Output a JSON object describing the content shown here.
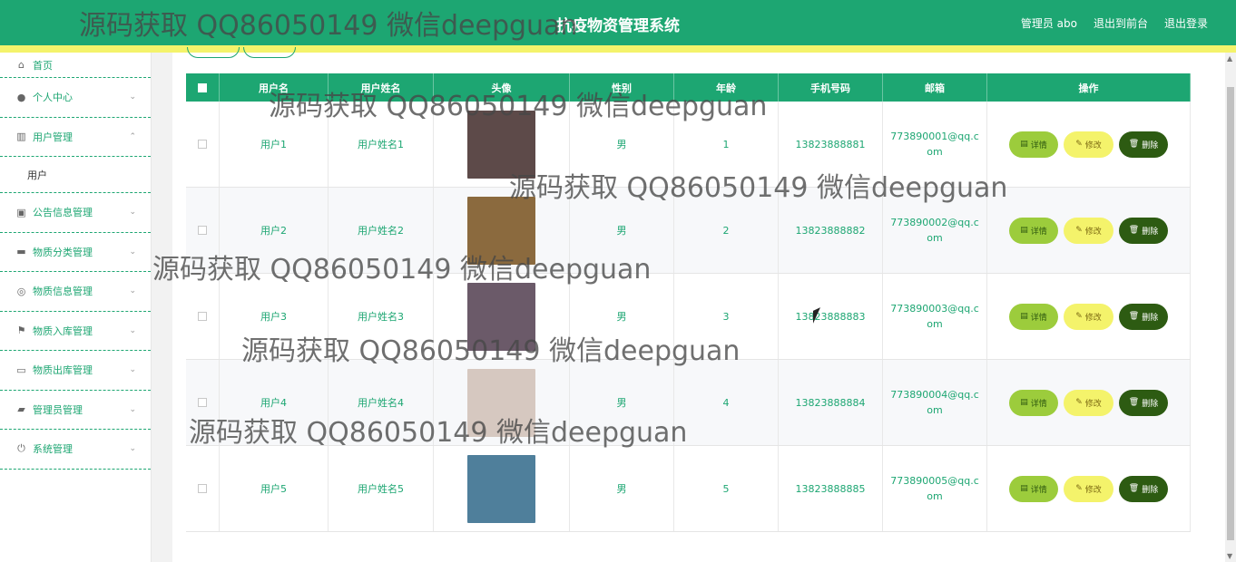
{
  "header": {
    "title": "抗疫物资管理系统",
    "links": [
      "管理员 abo",
      "退出到前台",
      "退出登录"
    ]
  },
  "sidebar": {
    "items": [
      {
        "label": "首页",
        "icon": "home-icon"
      },
      {
        "label": "个人中心",
        "icon": "user-icon"
      },
      {
        "label": "用户管理",
        "icon": "chart-icon"
      },
      {
        "label": "用户",
        "icon": ""
      },
      {
        "label": "公告信息管理",
        "icon": "clipboard-icon"
      },
      {
        "label": "物质分类管理",
        "icon": "briefcase-icon"
      },
      {
        "label": "物质信息管理",
        "icon": "target-icon"
      },
      {
        "label": "物质入库管理",
        "icon": "flag-icon"
      },
      {
        "label": "物质出库管理",
        "icon": "message-icon"
      },
      {
        "label": "管理员管理",
        "icon": "thumb-icon"
      },
      {
        "label": "系统管理",
        "icon": "power-icon"
      }
    ]
  },
  "table": {
    "headers": [
      "",
      "用户名",
      "用户姓名",
      "头像",
      "性别",
      "年龄",
      "手机号码",
      "邮箱",
      "操作"
    ],
    "rows": [
      {
        "username": "用户1",
        "name": "用户姓名1",
        "gender": "男",
        "age": "1",
        "phone": "13823888881",
        "email": "773890001@qq.com",
        "avatar_color": "#5d4a49"
      },
      {
        "username": "用户2",
        "name": "用户姓名2",
        "gender": "男",
        "age": "2",
        "phone": "13823888882",
        "email": "773890002@qq.com",
        "avatar_color": "#8b6a3e"
      },
      {
        "username": "用户3",
        "name": "用户姓名3",
        "gender": "男",
        "age": "3",
        "phone": "13823888883",
        "email": "773890003@qq.com",
        "avatar_color": "#6b5a69"
      },
      {
        "username": "用户4",
        "name": "用户姓名4",
        "gender": "男",
        "age": "4",
        "phone": "13823888884",
        "email": "773890004@qq.com",
        "avatar_color": "#d6c8c0"
      },
      {
        "username": "用户5",
        "name": "用户姓名5",
        "gender": "男",
        "age": "5",
        "phone": "13823888885",
        "email": "773890005@qq.com",
        "avatar_color": "#4f7f9b"
      }
    ],
    "actions": {
      "detail": "详情",
      "edit": "修改",
      "delete": "删除"
    }
  },
  "watermark": {
    "text": "源码获取 QQ86050149 微信deepguan"
  },
  "colors": {
    "primary": "#1da672",
    "accent": "#f4f36b",
    "danger": "#2d5b12"
  }
}
